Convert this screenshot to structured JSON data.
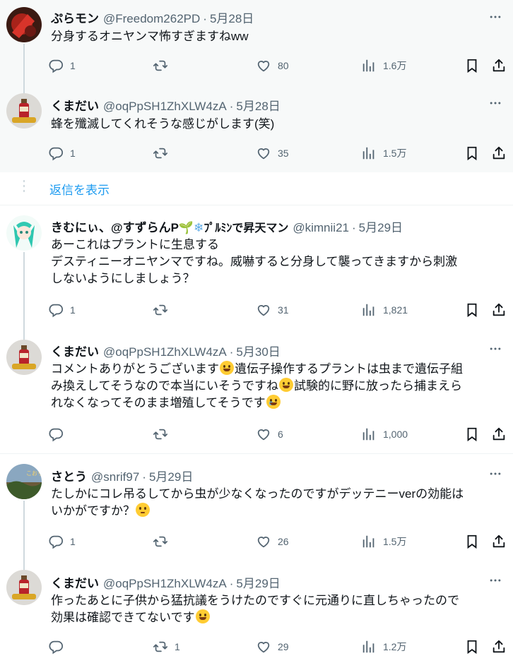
{
  "tweets": [
    {
      "name": "ぷらモン",
      "handle": "@Freedom262PD",
      "date": "5月28日",
      "text_lines": [
        "分身するオニヤンマ怖すぎますねww"
      ],
      "replies": "1",
      "retweets": "",
      "likes": "80",
      "views": "1.6万",
      "avatar": "red-plant"
    },
    {
      "name": "くまだい",
      "handle": "@oqPpSH1ZhXLW4zA",
      "date": "5月28日",
      "text_lines": [
        "蜂を殲滅してくれそうな感じがします(笑)"
      ],
      "replies": "1",
      "retweets": "",
      "likes": "35",
      "views": "1.5万",
      "avatar": "bottle"
    },
    {
      "name": "きむにぃ、@すずらんP",
      "name_suffix": "ﾌﾟﾙﾐﾝで昇天マン",
      "handle": "@kimnii21",
      "date": "5月29日",
      "text_lines": [
        "あーこれはプラントに生息する",
        "デスティニーオニヤンマですね。威嚇すると分身して襲ってきますから刺激",
        "しないようにしましょう？"
      ],
      "replies": "1",
      "retweets": "",
      "likes": "31",
      "views": "1,821",
      "avatar": "anime"
    },
    {
      "name": "くまだい",
      "handle": "@oqPpSH1ZhXLW4zA",
      "date": "5月30日",
      "text_parts": [
        "コメントありがとうございます",
        "遺伝子操作するプラントは虫まで遺伝子組",
        "み換えしてそうなので本当にいそうですね",
        "試験的に野に放ったら捕まえら",
        "れなくなってそのまま増殖してそうです"
      ],
      "replies": "",
      "retweets": "",
      "likes": "6",
      "views": "1,000",
      "avatar": "bottle"
    },
    {
      "name": "さとう",
      "handle": "@snrif97",
      "date": "5月29日",
      "text_lines": [
        "たしかにコレ吊るしてから虫が少なくなったのですがデッテニーverの効能は",
        "いかがですか？"
      ],
      "replies": "1",
      "retweets": "",
      "likes": "26",
      "views": "1.5万",
      "avatar": "landscape"
    },
    {
      "name": "くまだい",
      "handle": "@oqPpSH1ZhXLW4zA",
      "date": "5月29日",
      "text_lines": [
        "作ったあとに子供から猛抗議をうけたのですぐに元通りに直しちゃったので",
        "効果は確認できてないです"
      ],
      "replies": "",
      "retweets": "1",
      "likes": "29",
      "views": "1.2万",
      "avatar": "bottle"
    }
  ],
  "show_replies_label": "返信を表示",
  "colors": {
    "link": "#1d9bf0",
    "muted": "#536471",
    "thread": "#cfd9de",
    "shaded_bg": "#f7f9f9"
  },
  "icons": [
    "reply-icon",
    "retweet-icon",
    "like-icon",
    "views-icon",
    "bookmark-icon",
    "share-icon",
    "more-icon",
    "sprout-emoji",
    "snowflake-emoji"
  ]
}
